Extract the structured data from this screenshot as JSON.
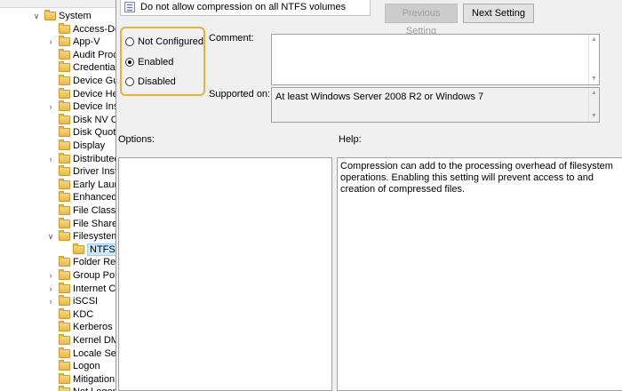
{
  "tree": {
    "items": [
      {
        "label": "System",
        "expander": "v"
      },
      {
        "label": "Access-De",
        "expander": ""
      },
      {
        "label": "App-V",
        "expander": ">"
      },
      {
        "label": "Audit Proc",
        "expander": ""
      },
      {
        "label": "Credential",
        "expander": ""
      },
      {
        "label": "Device Gu",
        "expander": ""
      },
      {
        "label": "Device He",
        "expander": ""
      },
      {
        "label": "Device Inst",
        "expander": ">"
      },
      {
        "label": "Disk NV Ca",
        "expander": ""
      },
      {
        "label": "Disk Quota",
        "expander": ""
      },
      {
        "label": "Display",
        "expander": ""
      },
      {
        "label": "Distributed",
        "expander": ">"
      },
      {
        "label": "Driver Insta",
        "expander": ""
      },
      {
        "label": "Early Laun",
        "expander": ""
      },
      {
        "label": "Enhanced",
        "expander": ""
      },
      {
        "label": "File Classif",
        "expander": ""
      },
      {
        "label": "File Share S",
        "expander": ""
      },
      {
        "label": "Filesystem",
        "expander": "v"
      },
      {
        "label": "NTFS",
        "expander": ""
      },
      {
        "label": "Folder Red",
        "expander": ""
      },
      {
        "label": "Group Poli",
        "expander": ">"
      },
      {
        "label": "Internet Co",
        "expander": ">"
      },
      {
        "label": "iSCSI",
        "expander": ">"
      },
      {
        "label": "KDC",
        "expander": ""
      },
      {
        "label": "Kerberos",
        "expander": ""
      },
      {
        "label": "Kernel DM",
        "expander": ""
      },
      {
        "label": "Locale Serv",
        "expander": ""
      },
      {
        "label": "Logon",
        "expander": ""
      },
      {
        "label": "Mitigation",
        "expander": ""
      },
      {
        "label": "Net Logon",
        "expander": ">"
      }
    ]
  },
  "dialog": {
    "setting_name": "Do not allow compression on all NTFS volumes",
    "prev_button": "Previous Setting",
    "next_button": "Next Setting",
    "options": [
      {
        "label": "Not Configured",
        "selected": false
      },
      {
        "label": "Enabled",
        "selected": true
      },
      {
        "label": "Disabled",
        "selected": false
      }
    ],
    "comment_label": "Comment:",
    "supported_label": "Supported on:",
    "supported_value": "At least Windows Server 2008 R2 or Windows 7",
    "options_label": "Options:",
    "help_label": "Help:",
    "help_text": "Compression can add to the processing overhead of filesystem operations.  Enabling this setting will prevent access to and creation of compressed files."
  },
  "colors": {
    "highlight": "#e8b23a",
    "selection": "#cce8ff"
  }
}
